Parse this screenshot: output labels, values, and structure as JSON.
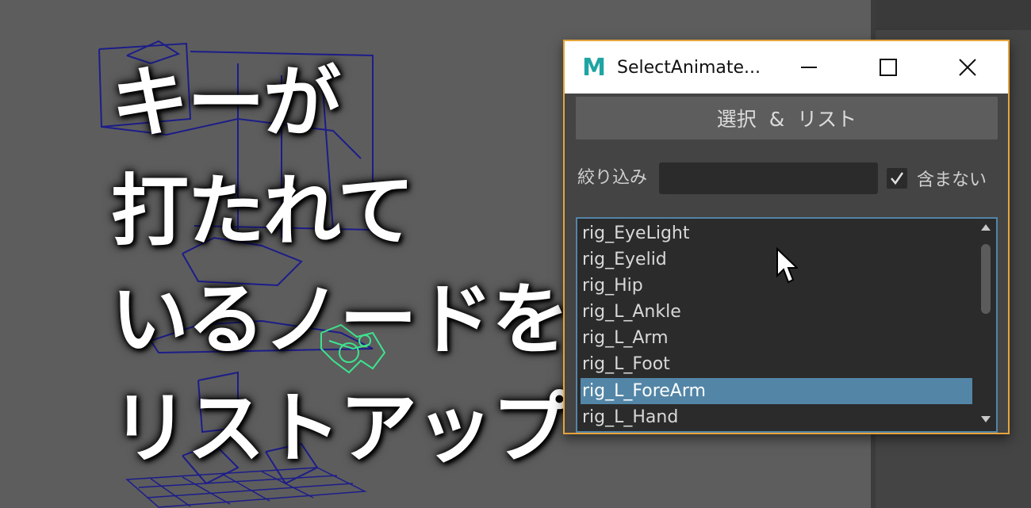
{
  "headline": {
    "lines": [
      "キーが",
      "打たれて",
      "いるノードを",
      "リストアップ"
    ]
  },
  "dialog": {
    "app_icon": "M",
    "title": "SelectAnimate...",
    "minimize_icon": "minimize-icon",
    "maximize_icon": "maximize-icon",
    "close_icon": "close-icon",
    "action_button_label": "選択 & リスト",
    "filter_label": "絞り込み",
    "filter_value": "",
    "exclude_checked": true,
    "exclude_label": "含まない",
    "nodes": [
      "rig_EyeLight",
      "rig_Eyelid",
      "rig_Hip",
      "rig_L_Ankle",
      "rig_L_Arm",
      "rig_L_Foot",
      "rig_L_ForeArm",
      "rig_L_Hand"
    ],
    "selected_node": "rig_L_ForeArm"
  },
  "colors": {
    "accent_border": "#e6a43a",
    "selection": "#5285a6",
    "rig_wire": "#1d1d8a",
    "rig_selected": "#3ee38f",
    "maya_icon": "#1fa3a3"
  }
}
